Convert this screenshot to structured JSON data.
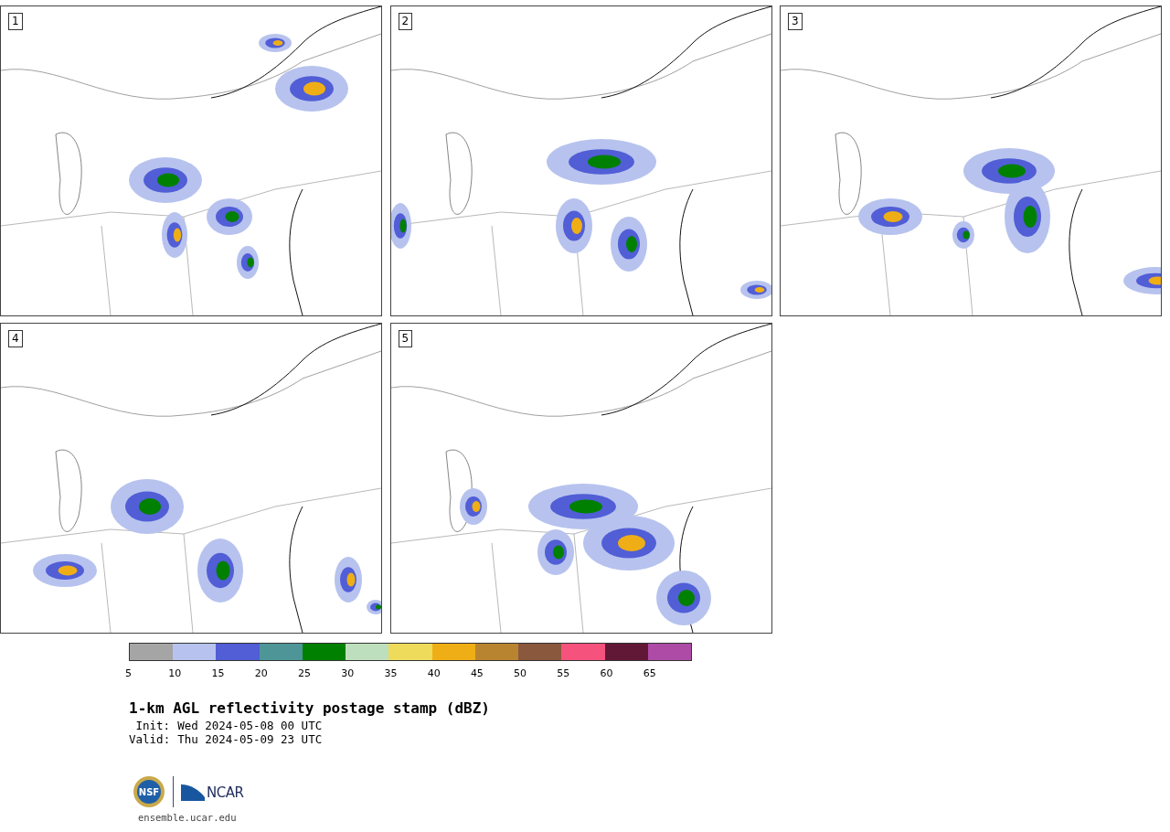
{
  "panels": [
    {
      "label": "1"
    },
    {
      "label": "2"
    },
    {
      "label": "3"
    },
    {
      "label": "4"
    },
    {
      "label": "5"
    }
  ],
  "colorbar": {
    "segments": [
      {
        "color": "#a5a5a5"
      },
      {
        "color": "#b7c3ee"
      },
      {
        "color": "#515ed6"
      },
      {
        "color": "#4e9598"
      },
      {
        "color": "#008000"
      },
      {
        "color": "#bedfbd"
      },
      {
        "color": "#eedb5b"
      },
      {
        "color": "#efae16"
      },
      {
        "color": "#b98430"
      },
      {
        "color": "#8a583d"
      },
      {
        "color": "#f5527e"
      },
      {
        "color": "#611836"
      },
      {
        "color": "#ad4ba6"
      }
    ],
    "ticks": [
      "5",
      "10",
      "15",
      "20",
      "25",
      "30",
      "35",
      "40",
      "45",
      "50",
      "55",
      "60",
      "65"
    ]
  },
  "title": "1-km AGL reflectivity postage stamp (dBZ)",
  "times": [
    {
      "label": "Init:",
      "value": "Wed 2024-05-08 00 UTC"
    },
    {
      "label": "Valid:",
      "value": "Thu 2024-05-09 23 UTC"
    }
  ],
  "logos": {
    "nsf": "NSF",
    "ncar": "NCAR"
  },
  "url": "ensemble.ucar.edu"
}
